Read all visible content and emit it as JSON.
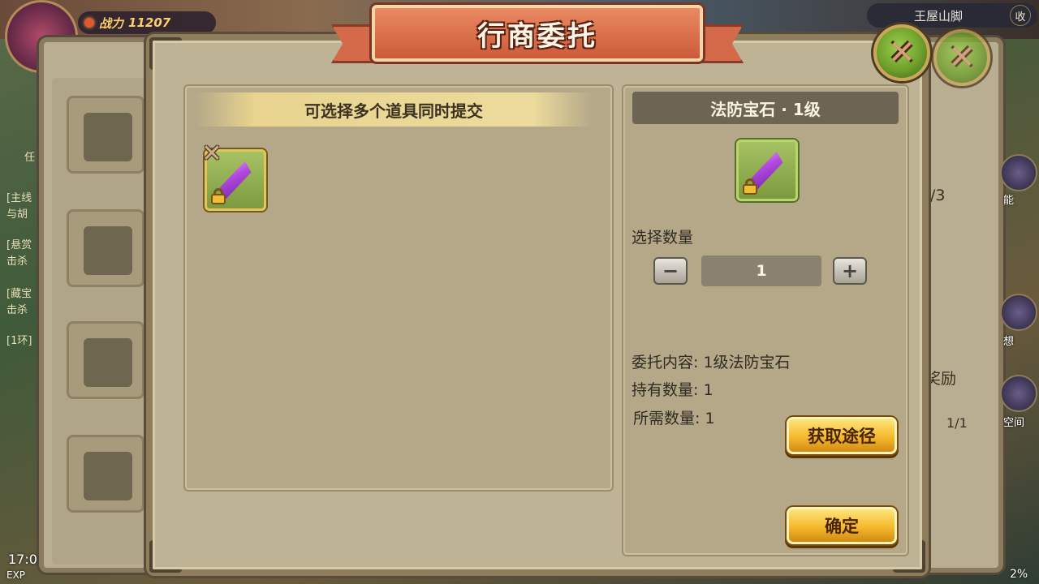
{
  "hud": {
    "power_label": "战力",
    "power_value": "11207",
    "location": "王屋山脚",
    "collapse_label": "收",
    "time_prefix": "17:0",
    "exp_prefix": "EXP",
    "right_percent": "2%"
  },
  "background": {
    "side_tasks": [
      "[主线",
      "与胡",
      "[悬赏",
      "击杀",
      "[藏宝",
      "击杀",
      "[1环]"
    ],
    "tab_fragment": "任",
    "counter_fragment": "/3",
    "reward_fragment": "奖励",
    "progress_fragment": "1/1",
    "right_labels": [
      "能",
      "想",
      "空间"
    ]
  },
  "dialog": {
    "title": "行商委托",
    "left": {
      "hint": "可选择多个道具同时提交",
      "items": [
        {
          "name": "法防宝石·1级",
          "locked": true,
          "icon": "purple-crystal-icon"
        }
      ]
    },
    "right": {
      "item_title": "法防宝石 · 1级",
      "select_qty_label": "选择数量",
      "qty_value": "1",
      "minus_label": "−",
      "plus_label": "+",
      "commission_content": "委托内容: 1级法防宝石",
      "owned_qty": "持有数量: 1",
      "required_qty": "所需数量: 1",
      "obtain_button": "获取途径",
      "confirm_button": "确定"
    }
  }
}
